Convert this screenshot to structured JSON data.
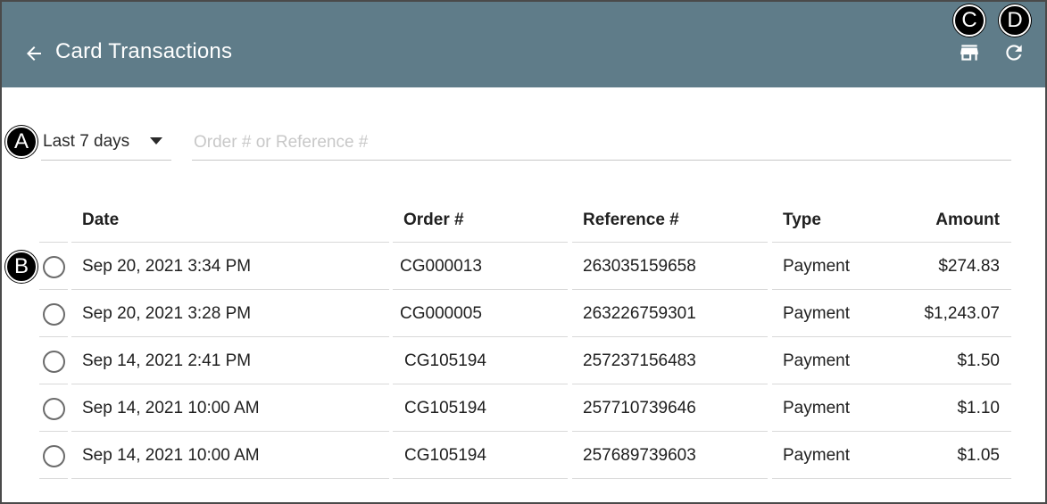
{
  "header": {
    "title": "Card Transactions",
    "back_icon": "arrow-left-icon",
    "actions": [
      {
        "icon": "store-icon"
      },
      {
        "icon": "refresh-icon"
      }
    ]
  },
  "callouts": {
    "a": "A",
    "b": "B",
    "c": "C",
    "d": "D"
  },
  "filters": {
    "period": "Last 7 days",
    "search_placeholder": "Order # or Reference #",
    "search_value": ""
  },
  "table": {
    "columns": [
      "Date",
      "Order #",
      "Reference #",
      "Type",
      "Amount"
    ],
    "rows": [
      {
        "date": "Sep 20, 2021 3:34 PM",
        "order": "CG000013",
        "reference": "263035159658",
        "type": "Payment",
        "amount": "$274.83"
      },
      {
        "date": "Sep 20, 2021 3:28 PM",
        "order": "CG000005",
        "reference": "263226759301",
        "type": "Payment",
        "amount": "$1,243.07"
      },
      {
        "date": "Sep 14, 2021 2:41 PM",
        "order": "CG105194",
        "reference": "257237156483",
        "type": "Payment",
        "amount": "$1.50"
      },
      {
        "date": "Sep 14, 2021 10:00 AM",
        "order": "CG105194",
        "reference": "257710739646",
        "type": "Payment",
        "amount": "$1.10"
      },
      {
        "date": "Sep 14, 2021 10:00 AM",
        "order": "CG105194",
        "reference": "257689739603",
        "type": "Payment",
        "amount": "$1.05"
      }
    ]
  },
  "colors": {
    "appbar": "#5f7c89",
    "divider": "#d9d9d9",
    "placeholder": "#c8c8c8"
  }
}
